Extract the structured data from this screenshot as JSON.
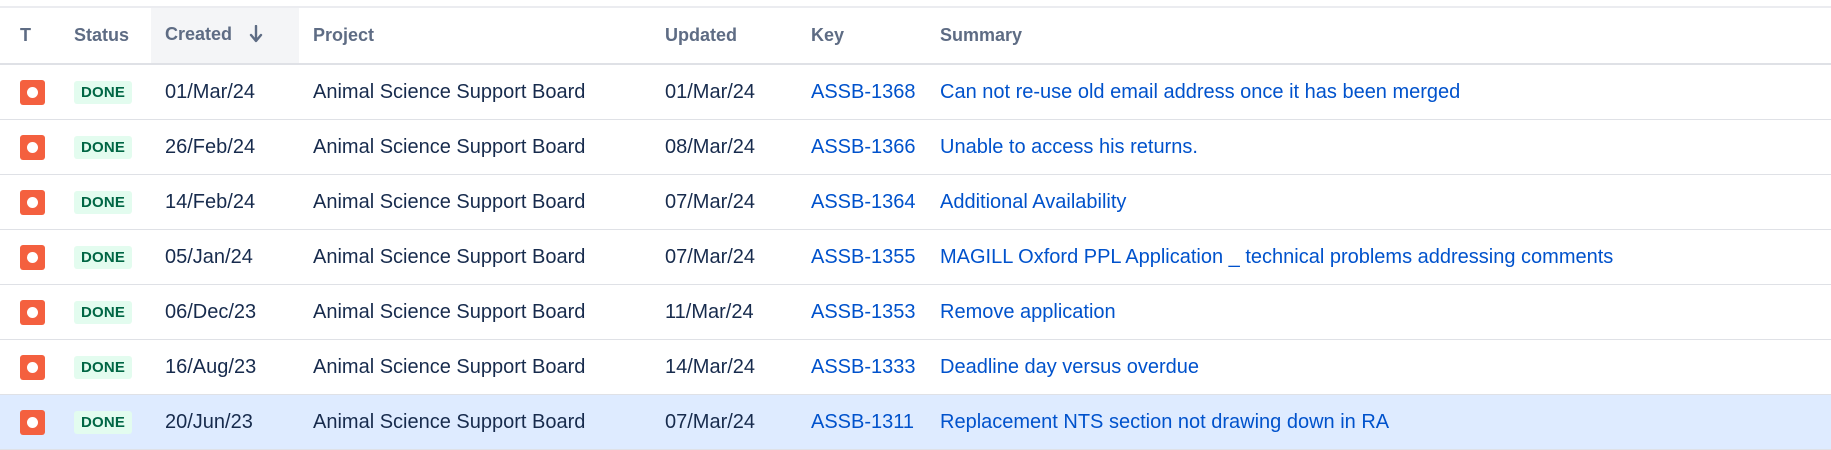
{
  "columns": {
    "type": "T",
    "status": "Status",
    "created": "Created",
    "project": "Project",
    "updated": "Updated",
    "key": "Key",
    "summary": "Summary"
  },
  "sort": {
    "column": "created",
    "direction": "descending",
    "icon": "arrow-down-icon"
  },
  "colors": {
    "bug_icon": "#f4603f",
    "done_badge_bg": "#e3fcef",
    "done_badge_text": "#006644",
    "link": "#0052cc",
    "selected_row": "#deebff"
  },
  "rows": [
    {
      "type_icon": "bug-icon",
      "status": "DONE",
      "created": "01/Mar/24",
      "project": "Animal Science Support Board",
      "updated": "01/Mar/24",
      "key": "ASSB-1368",
      "summary": "Can not re-use old email address once it has been merged"
    },
    {
      "type_icon": "bug-icon",
      "status": "DONE",
      "created": "26/Feb/24",
      "project": "Animal Science Support Board",
      "updated": "08/Mar/24",
      "key": "ASSB-1366",
      "summary": "Unable to access his returns."
    },
    {
      "type_icon": "bug-icon",
      "status": "DONE",
      "created": "14/Feb/24",
      "project": "Animal Science Support Board",
      "updated": "07/Mar/24",
      "key": "ASSB-1364",
      "summary": "Additional Availability"
    },
    {
      "type_icon": "bug-icon",
      "status": "DONE",
      "created": "05/Jan/24",
      "project": "Animal Science Support Board",
      "updated": "07/Mar/24",
      "key": "ASSB-1355",
      "summary": "MAGILL Oxford PPL Application _ technical problems addressing comments"
    },
    {
      "type_icon": "bug-icon",
      "status": "DONE",
      "created": "06/Dec/23",
      "project": "Animal Science Support Board",
      "updated": "11/Mar/24",
      "key": "ASSB-1353",
      "summary": "Remove application"
    },
    {
      "type_icon": "bug-icon",
      "status": "DONE",
      "created": "16/Aug/23",
      "project": "Animal Science Support Board",
      "updated": "14/Mar/24",
      "key": "ASSB-1333",
      "summary": "Deadline day versus overdue"
    },
    {
      "type_icon": "bug-icon",
      "status": "DONE",
      "created": "20/Jun/23",
      "project": "Animal Science Support Board",
      "updated": "07/Mar/24",
      "key": "ASSB-1311",
      "summary": "Replacement NTS section not drawing down in RA",
      "selected": true
    }
  ]
}
